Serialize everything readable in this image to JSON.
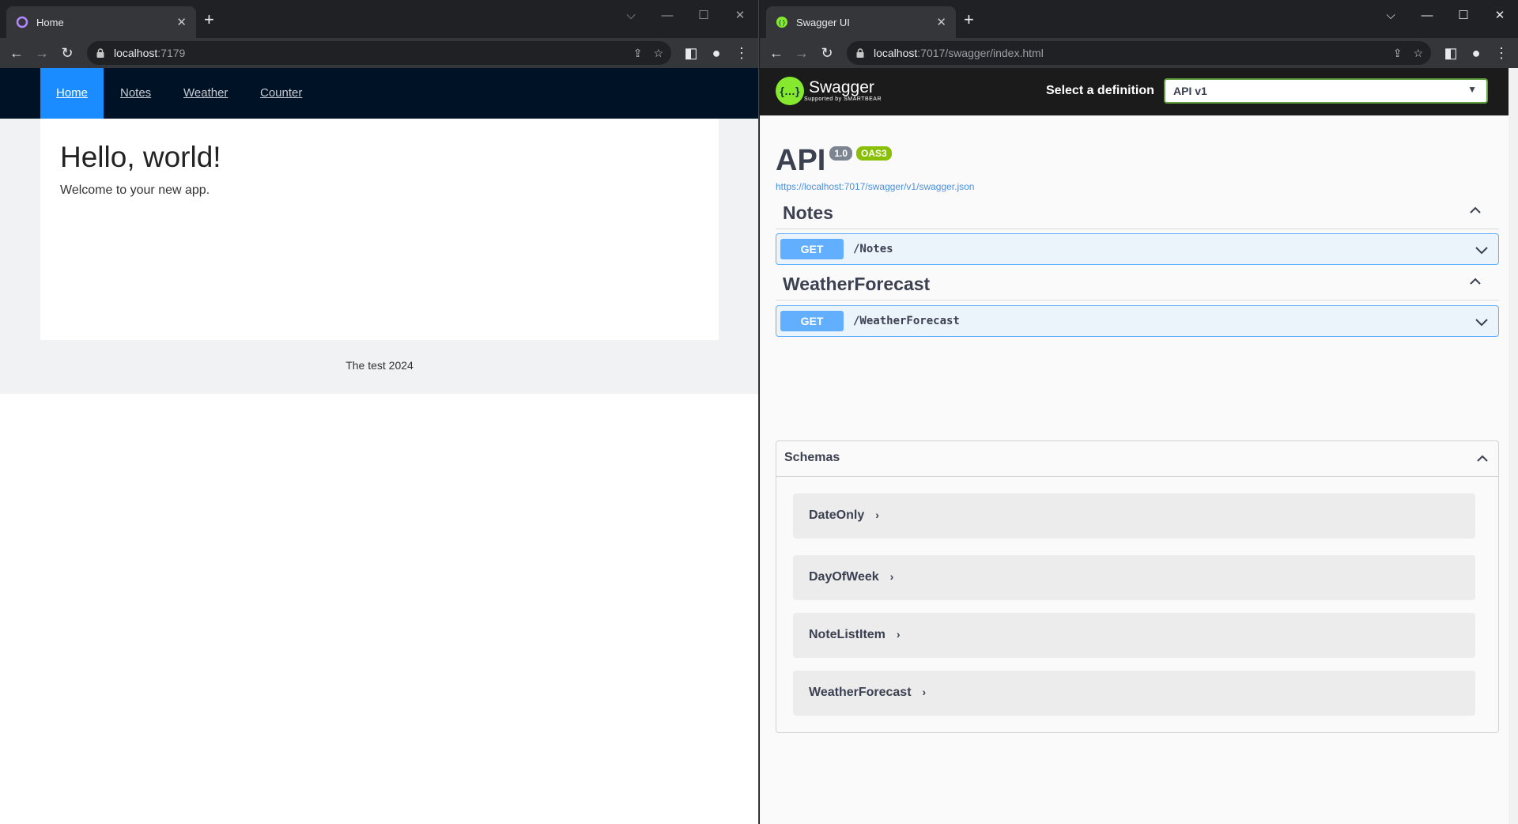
{
  "left_window": {
    "tab_title": "Home",
    "url_host": "localhost",
    "url_rest": ":7179",
    "nav": [
      {
        "label": "Home",
        "active": true
      },
      {
        "label": "Notes",
        "active": false
      },
      {
        "label": "Weather",
        "active": false
      },
      {
        "label": "Counter",
        "active": false
      }
    ],
    "heading": "Hello, world!",
    "welcome": "Welcome to your new app.",
    "footer": "The test 2024"
  },
  "right_window": {
    "tab_title": "Swagger UI",
    "url_host": "localhost",
    "url_rest": ":7017/swagger/index.html",
    "swagger": {
      "logo_text": "Swagger",
      "logo_sub": "Supported by SMARTBEAR",
      "select_label": "Select a definition",
      "selected_definition": "API v1",
      "api_title": "API",
      "version_badge": "1.0",
      "oas_badge": "OAS3",
      "spec_url": "https://localhost:7017/swagger/v1/swagger.json",
      "tags": [
        {
          "name": "Notes",
          "method": "GET",
          "path": "/Notes"
        },
        {
          "name": "WeatherForecast",
          "method": "GET",
          "path": "/WeatherForecast"
        }
      ],
      "schemas_title": "Schemas",
      "schemas": [
        "DateOnly",
        "DayOfWeek",
        "NoteListItem",
        "WeatherForecast"
      ]
    }
  },
  "colors": {
    "app_nav": "#001226",
    "app_nav_active": "#1b8cff",
    "swagger_green": "#85ea2d",
    "get_blue": "#61affe"
  }
}
